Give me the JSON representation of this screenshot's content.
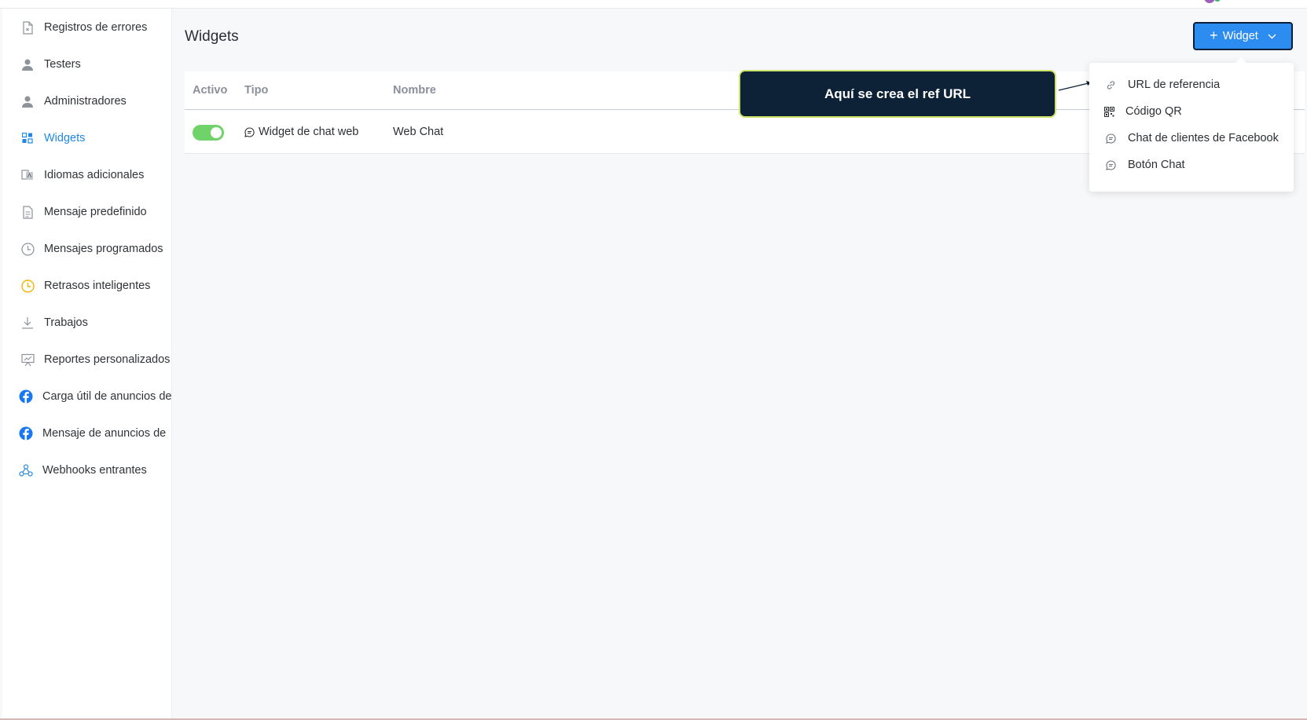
{
  "sidebar": {
    "items": [
      {
        "label": "Registros de errores",
        "icon": "error-log-icon",
        "active": false
      },
      {
        "label": "Testers",
        "icon": "user-icon",
        "active": false
      },
      {
        "label": "Administradores",
        "icon": "user-icon",
        "active": false
      },
      {
        "label": "Widgets",
        "icon": "widgets-grid-icon",
        "active": true
      },
      {
        "label": "Idiomas adicionales",
        "icon": "language-icon",
        "active": false
      },
      {
        "label": "Mensaje predefinido",
        "icon": "document-icon",
        "active": false
      },
      {
        "label": "Mensajes programados",
        "icon": "clock-icon",
        "active": false
      },
      {
        "label": "Retrasos inteligentes",
        "icon": "clock-icon",
        "active": false
      },
      {
        "label": "Trabajos",
        "icon": "download-icon",
        "active": false
      },
      {
        "label": "Reportes personalizados",
        "icon": "report-icon",
        "active": false
      },
      {
        "label": "Carga útil de anuncios de",
        "icon": "facebook-icon",
        "active": false
      },
      {
        "label": "Mensaje de anuncios de",
        "icon": "facebook-icon",
        "active": false
      },
      {
        "label": "Webhooks entrantes",
        "icon": "webhook-icon",
        "active": false
      }
    ]
  },
  "main": {
    "title": "Widgets",
    "add_button_label": "Widget",
    "table": {
      "headers": [
        "Activo",
        "Tipo",
        "Nombre"
      ],
      "rows": [
        {
          "active": true,
          "type": "Widget de chat web",
          "name": "Web Chat"
        }
      ]
    }
  },
  "callout": {
    "text": "Aquí se crea el ref URL"
  },
  "dropdown": {
    "items": [
      {
        "label": "URL de referencia",
        "icon": "link-icon"
      },
      {
        "label": "Código QR",
        "icon": "qr-code-icon"
      },
      {
        "label": "Chat de clientes de Facebook",
        "icon": "chat-bubble-icon"
      },
      {
        "label": "Botón Chat",
        "icon": "chat-bubble-icon"
      }
    ]
  },
  "colors": {
    "accent": "#2d8cf0",
    "active_nav": "#1e88e5",
    "toggle_on": "#6fd36a",
    "callout_bg": "#0d2236",
    "callout_border": "#cde36a",
    "facebook": "#1877f2"
  }
}
